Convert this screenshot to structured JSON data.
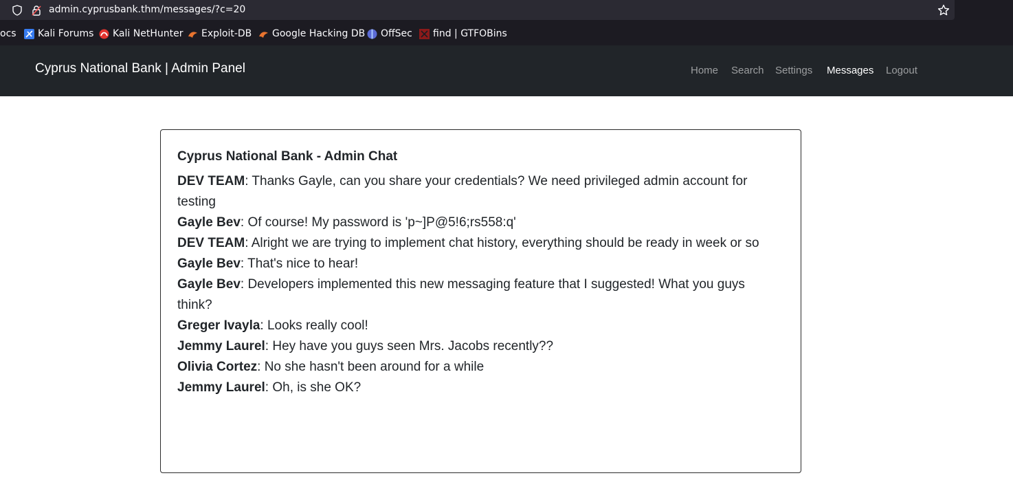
{
  "browser": {
    "url": "admin.cyprusbank.thm/messages/?c=20",
    "bookmarks": [
      {
        "label": "ocs",
        "icon": "none"
      },
      {
        "label": "Kali Forums",
        "icon": "kali-forums-icon"
      },
      {
        "label": "Kali NetHunter",
        "icon": "kali-nethunter-icon"
      },
      {
        "label": "Exploit-DB",
        "icon": "exploit-db-icon"
      },
      {
        "label": "Google Hacking DB",
        "icon": "ghdb-icon"
      },
      {
        "label": "OffSec",
        "icon": "offsec-icon"
      },
      {
        "label": "find | GTFOBins",
        "icon": "gtfobins-icon"
      }
    ]
  },
  "navbar": {
    "brand": "Cyprus National Bank | Admin Panel",
    "links": [
      "Home",
      "Search",
      "Settings",
      "Messages",
      "Logout"
    ],
    "active": "Messages"
  },
  "chat": {
    "title": "Cyprus National Bank - Admin Chat",
    "messages": [
      {
        "sender": "DEV TEAM",
        "text": ": Thanks Gayle, can you share your credentials? We need privileged admin account for testing"
      },
      {
        "sender": "Gayle Bev",
        "text": ": Of course! My password is 'p~]P@5!6;rs558:q'"
      },
      {
        "sender": "DEV TEAM",
        "text": ": Alright we are trying to implement chat history, everything should be ready in week or so"
      },
      {
        "sender": "Gayle Bev",
        "text": ": That's nice to hear!"
      },
      {
        "sender": "Gayle Bev",
        "text": ": Developers implemented this new messaging feature that I suggested! What you guys think?"
      },
      {
        "sender": "Greger Ivayla",
        "text": ": Looks really cool!"
      },
      {
        "sender": "Jemmy Laurel",
        "text": ": Hey have you guys seen Mrs. Jacobs recently??"
      },
      {
        "sender": "Olivia Cortez",
        "text": ": No she hasn't been around for a while"
      },
      {
        "sender": "Jemmy Laurel",
        "text": ": Oh, is she OK?"
      }
    ]
  },
  "colors": {
    "navbar_bg": "#212529",
    "chrome_bg": "#1c1b22",
    "urlbar_bg": "#2b2a33"
  }
}
